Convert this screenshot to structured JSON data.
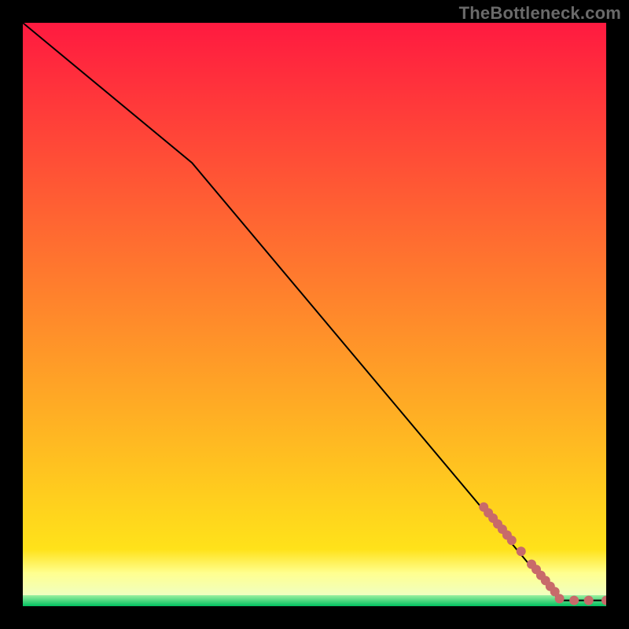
{
  "watermark": "TheBottleneck.com",
  "chart_data": {
    "type": "line",
    "title": "",
    "xlabel": "",
    "ylabel": "",
    "xlim": [
      0,
      100
    ],
    "ylim": [
      0,
      100
    ],
    "series": [
      {
        "name": "curve",
        "points": [
          {
            "x": 0,
            "y": 100
          },
          {
            "x": 29,
            "y": 76
          },
          {
            "x": 92,
            "y": 1
          },
          {
            "x": 100,
            "y": 1
          }
        ]
      },
      {
        "name": "highlight-dots",
        "points": [
          {
            "x": 79.0,
            "y": 17.0
          },
          {
            "x": 79.8,
            "y": 16.0
          },
          {
            "x": 80.6,
            "y": 15.1
          },
          {
            "x": 81.4,
            "y": 14.1
          },
          {
            "x": 82.2,
            "y": 13.2
          },
          {
            "x": 83.0,
            "y": 12.2
          },
          {
            "x": 83.8,
            "y": 11.3
          },
          {
            "x": 85.4,
            "y": 9.4
          },
          {
            "x": 87.2,
            "y": 7.2
          },
          {
            "x": 88.0,
            "y": 6.3
          },
          {
            "x": 88.8,
            "y": 5.3
          },
          {
            "x": 89.6,
            "y": 4.4
          },
          {
            "x": 90.4,
            "y": 3.4
          },
          {
            "x": 91.2,
            "y": 2.5
          },
          {
            "x": 92.0,
            "y": 1.3
          },
          {
            "x": 94.5,
            "y": 1.0
          },
          {
            "x": 97.0,
            "y": 1.0
          },
          {
            "x": 100.0,
            "y": 1.0
          }
        ]
      }
    ],
    "gradient_bands": [
      {
        "from": 0,
        "to": 670,
        "top_color": "#ff1a40",
        "bottom_color": "#ffe21a"
      },
      {
        "from": 670,
        "to": 700,
        "top_color": "#ffe21a",
        "bottom_color": "#ffff90"
      },
      {
        "from": 700,
        "to": 728,
        "top_color": "#ffff90",
        "bottom_color": "#f0ffc0"
      },
      {
        "from": 728,
        "to": 742,
        "top_color": "#9bf0a0",
        "bottom_color": "#00c060"
      }
    ],
    "dot_color": "#c86a6a",
    "line_color": "#000000"
  }
}
